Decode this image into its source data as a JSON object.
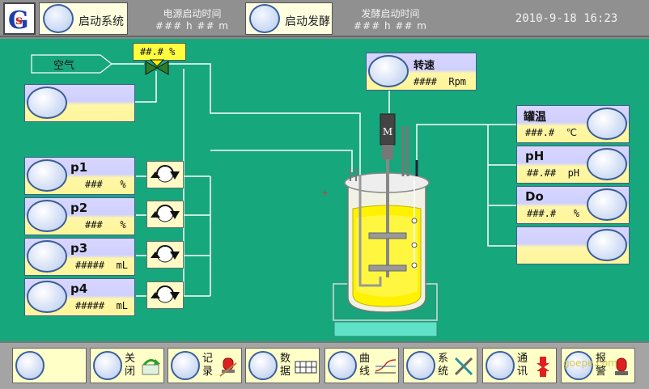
{
  "header": {
    "start_system_label": "启动系统",
    "power_time_title": "电源启动时间",
    "power_time_value": "### h ## m",
    "start_ferment_label": "启动发酵",
    "ferment_time_title": "发酵启动时间",
    "ferment_time_value": "### h ## m",
    "datetime": "2010-9-18 16:23"
  },
  "air": {
    "label": "空气",
    "valve_value": "##.# %"
  },
  "speed": {
    "label": "转速",
    "value": "####  Rpm"
  },
  "pumps": [
    {
      "name": "p1",
      "value": "###   %"
    },
    {
      "name": "p2",
      "value": "###   %"
    },
    {
      "name": "p3",
      "value": "#####  mL"
    },
    {
      "name": "p4",
      "value": "#####  mL"
    }
  ],
  "sensors": [
    {
      "name": "罐温",
      "value": "###.#  ℃"
    },
    {
      "name": "pH",
      "value": "##.##  pH"
    },
    {
      "name": "Do",
      "value": "###.#   %"
    },
    {
      "name": "",
      "value": ""
    }
  ],
  "motor_label": "M",
  "footer": {
    "buttons": [
      {
        "label": "",
        "icon": "blank"
      },
      {
        "label": "关闭",
        "icon": "close-arrow-icon"
      },
      {
        "label": "记录",
        "icon": "record-alarm-icon"
      },
      {
        "label": "数据",
        "icon": "data-grid-icon"
      },
      {
        "label": "曲线",
        "icon": "curve-icon"
      },
      {
        "label": "系统",
        "icon": "system-tools-icon"
      },
      {
        "label": "通讯",
        "icon": "communication-arrows-icon"
      },
      {
        "label": "报警",
        "icon": "alarm-light-icon"
      }
    ],
    "watermark": "goepe.com"
  },
  "colors": {
    "background": "#17a77c",
    "header": "#909090",
    "panel_top": "#d9d6ff",
    "panel_bottom": "#fff59a",
    "knob_border": "#3a5d95",
    "liquid": "#fff200"
  }
}
